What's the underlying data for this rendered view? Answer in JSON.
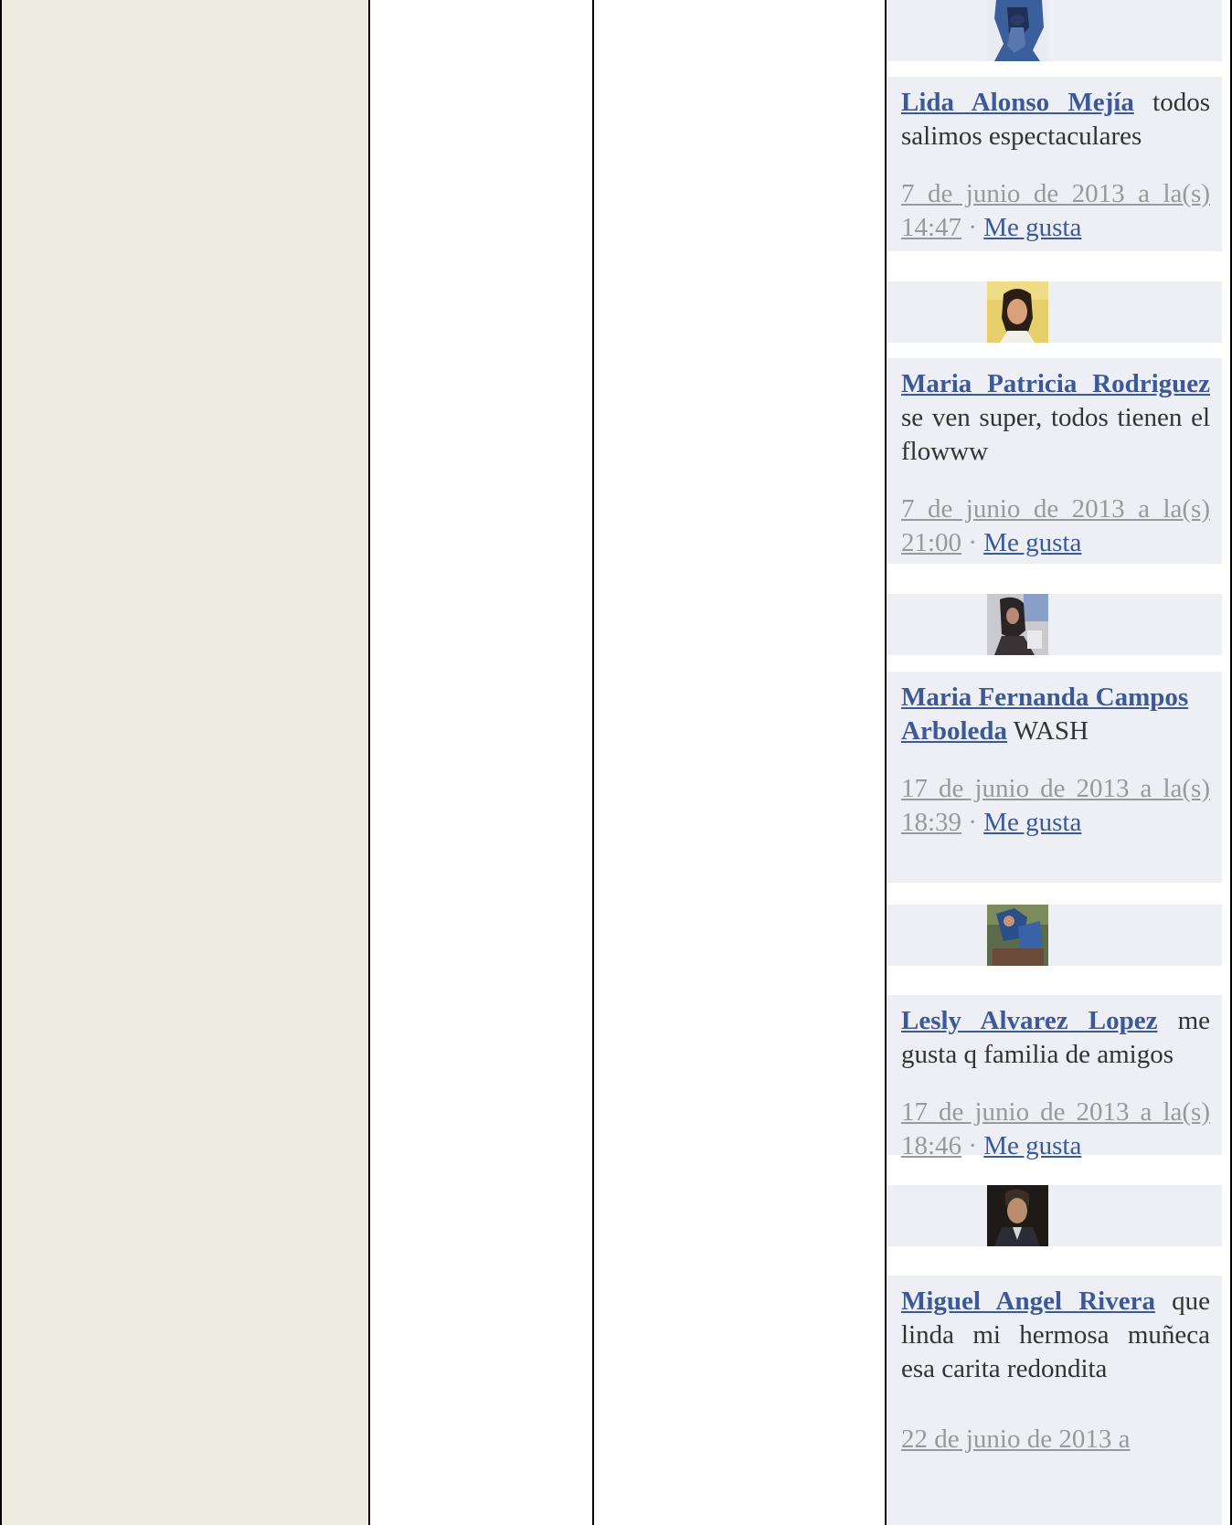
{
  "comments": [
    {
      "author": "Lida Alonso Mejía",
      "text": " todos salimos espectaculares",
      "timestamp": "7 de junio de 2013 a la(s) 14:47",
      "separator": " · ",
      "like": "Me gusta"
    },
    {
      "author": "Maria Patricia Rodriguez",
      "text": " se ven super, todos tienen el flowww",
      "timestamp": "7 de junio de 2013 a la(s) 21:00",
      "separator": " · ",
      "like": "Me gusta"
    },
    {
      "author": "Maria Fernanda Campos Arboleda",
      "text": " WASH",
      "timestamp": "17 de junio de 2013 a la(s) 18:39",
      "separator": " · ",
      "like": "Me gusta"
    },
    {
      "author": "Lesly Alvarez Lopez",
      "text": " me gusta q familia de amigos",
      "timestamp": "17 de junio de 2013 a la(s) 18:46",
      "separator": " · ",
      "like": "Me gusta"
    },
    {
      "author": "Miguel Angel Rivera",
      "text": " que linda mi hermosa muñeca esa carita redondita",
      "timestamp": "22 de junio de 2013 a",
      "separator": "",
      "like": ""
    }
  ]
}
